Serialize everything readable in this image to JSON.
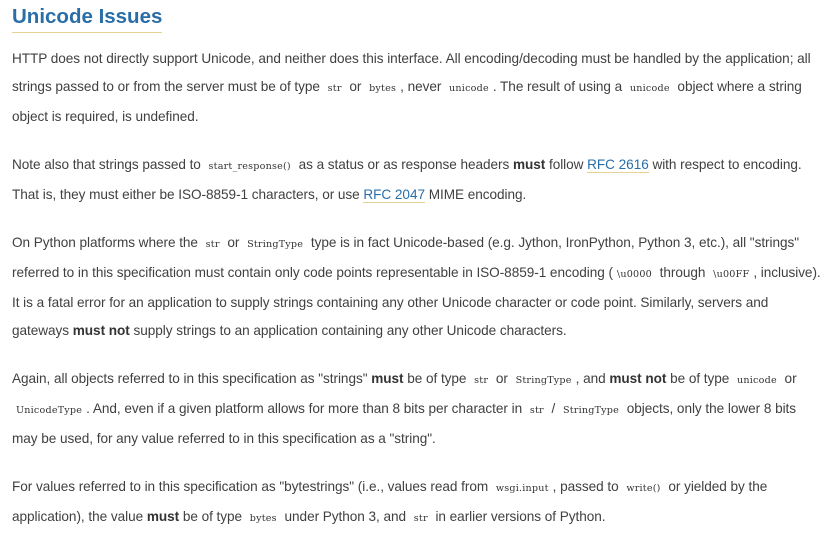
{
  "heading": "Unicode Issues",
  "p1": {
    "t1": "HTTP does not directly support Unicode, and neither does this interface. All encoding/decoding must be handled by the application; all strings passed to or from the server must be of type ",
    "c1": "str",
    "t2": " or ",
    "c2": "bytes",
    "t3": ", never ",
    "c3": "unicode",
    "t4": ". The result of using a ",
    "c4": "unicode",
    "t5": " object where a string object is required, is undefined."
  },
  "p2": {
    "t1": "Note also that strings passed to ",
    "c1": "start_response()",
    "t2": " as a status or as response headers ",
    "s1": "must",
    "t3": " follow ",
    "l1": "RFC 2616",
    "t4": " with respect to encoding. That is, they must either be ISO-8859-1 characters, or use ",
    "l2": "RFC 2047",
    "t5": " MIME encoding."
  },
  "p3": {
    "t1": "On Python platforms where the ",
    "c1": "str",
    "t2": " or ",
    "c2": "StringType",
    "t3": " type is in fact Unicode-based (e.g. Jython, IronPython, Python 3, etc.), all \"strings\" referred to in this specification must contain only code points representable in ISO-8859-1 encoding (",
    "c3": "\\u0000",
    "t4": " through ",
    "c4": "\\u00FF",
    "t5": ", inclusive). It is a fatal error for an application to supply strings containing any other Unicode character or code point. Similarly, servers and gateways ",
    "s1": "must not",
    "t6": " supply strings to an application containing any other Unicode characters."
  },
  "p4": {
    "t1": "Again, all objects referred to in this specification as \"strings\" ",
    "s1": "must",
    "t2": " be of type ",
    "c1": "str",
    "t3": " or ",
    "c2": "StringType",
    "t4": ", and ",
    "s2": "must not",
    "t5": " be of type ",
    "c3": "unicode",
    "t6": " or ",
    "c4": "UnicodeType",
    "t7": ". And, even if a given platform allows for more than 8 bits per character in ",
    "c5": "str",
    "t8": " / ",
    "c6": "StringType",
    "t9": " objects, only the lower 8 bits may be used, for any value referred to in this specification as a \"string\"."
  },
  "p5": {
    "t1": "For values referred to in this specification as \"bytestrings\" (i.e., values read from ",
    "c1": "wsgi.input",
    "t2": ", passed to ",
    "c2": "write()",
    "t3": " or yielded by the application), the value ",
    "s1": "must",
    "t4": " be of type ",
    "c3": "bytes",
    "t5": " under Python 3, and ",
    "c4": "str",
    "t6": " in earlier versions of Python."
  }
}
